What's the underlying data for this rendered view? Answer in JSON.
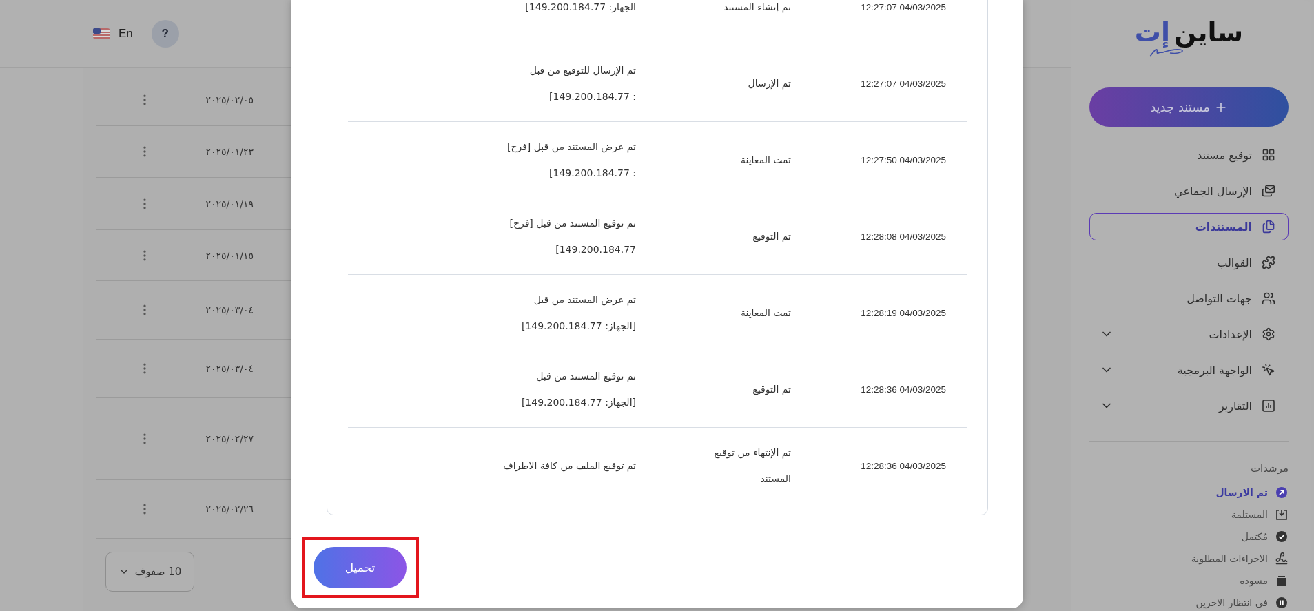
{
  "header": {
    "language": "En",
    "help": "?"
  },
  "documents_table": {
    "rows": [
      {
        "date": "٢٠٢٥/٠٢/٠٥"
      },
      {
        "date": "٢٠٢٥/٠١/٢٣"
      },
      {
        "date": "٢٠٢٥/٠١/١٩"
      },
      {
        "date": "٢٠٢٥/٠١/١٥"
      },
      {
        "date": "٢٠٢٥/٠٣/٠٤"
      },
      {
        "date": "٢٠٢٥/٠٣/٠٤"
      },
      {
        "date": "٢٠٢٥/٠٢/٢٧"
      },
      {
        "date": "٢٠٢٥/٠٢/٢٦"
      }
    ],
    "rows_per_page": "10 صفوف"
  },
  "history_dialog": {
    "rows": [
      {
        "time": "12:27:07 04/03/2025",
        "event": "تم إنشاء المستند",
        "details": [
          "الجهاز: 149.200.184.77]"
        ]
      },
      {
        "time": "12:27:07 04/03/2025",
        "event": "تم الإرسال",
        "details": [
          "تم الإرسال للتوقيع من قبل",
          ": 149.200.184.77]"
        ]
      },
      {
        "time": "12:27:50 04/03/2025",
        "event": "تمت المعاينة",
        "details": [
          "تم عرض المستند من قبل [فرح]",
          ": 149.200.184.77]"
        ]
      },
      {
        "time": "12:28:08 04/03/2025",
        "event": "تم التوقيع",
        "details": [
          "تم توقيع المستند من قبل [فرح]",
          "149.200.184.77]"
        ]
      },
      {
        "time": "12:28:19 04/03/2025",
        "event": "تمت المعاينة",
        "details": [
          "تم عرض المستند من قبل",
          "[الجهاز: 149.200.184.77]"
        ]
      },
      {
        "time": "12:28:36 04/03/2025",
        "event": "تم التوقيع",
        "details": [
          "تم توقيع المستند من قبل",
          "[الجهاز: 149.200.184.77]"
        ]
      },
      {
        "time": "12:28:36 04/03/2025",
        "event": "تم الإنتهاء من توقيع المستند",
        "details": [
          "تم توقيع الملف من كافة الاطراف"
        ]
      }
    ],
    "download_button": "تحميل"
  },
  "sidebar": {
    "logo": {
      "text": "ساين",
      "accent": "إت"
    },
    "new_document": "مستند جديد",
    "items": [
      {
        "label": "توقيع مستند",
        "kind": "link",
        "selected": false
      },
      {
        "label": "الإرسال الجماعي",
        "kind": "link",
        "selected": false
      },
      {
        "label": "المستندات",
        "kind": "link",
        "selected": true
      },
      {
        "label": "القوالب",
        "kind": "link",
        "selected": false
      },
      {
        "label": "جهات التواصل",
        "kind": "link",
        "selected": false
      },
      {
        "label": "الإعدادات",
        "kind": "group",
        "selected": false
      },
      {
        "label": "الواجهة البرمجية",
        "kind": "group",
        "selected": false
      },
      {
        "label": "التقارير",
        "kind": "group",
        "selected": false
      }
    ],
    "filters_title": "مرشدات",
    "filters": [
      {
        "label": "تم الارسال",
        "selected": true
      },
      {
        "label": "المستلمة",
        "selected": false
      },
      {
        "label": "مُكتمل",
        "selected": false
      },
      {
        "label": "الاجراءات المطلوبة",
        "selected": false
      },
      {
        "label": "مسودة",
        "selected": false
      },
      {
        "label": "في انتظار الاخرين",
        "selected": false
      }
    ]
  }
}
